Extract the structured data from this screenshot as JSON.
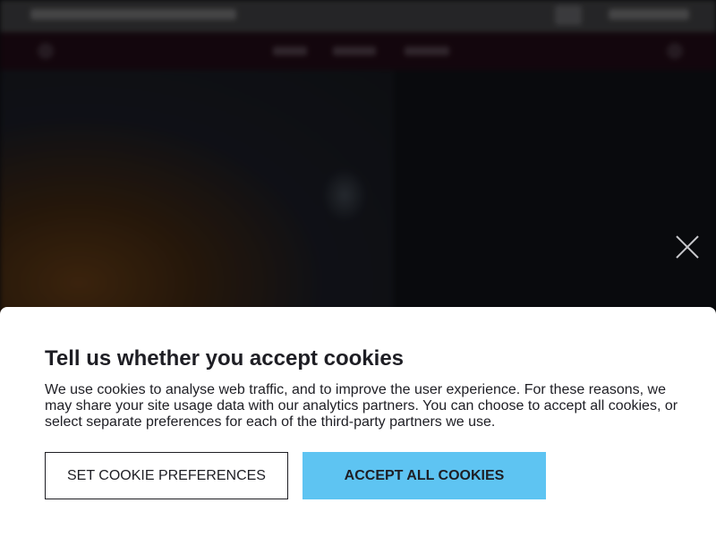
{
  "overlay": {
    "close_icon": "close-icon"
  },
  "cookie_banner": {
    "title": "Tell us whether you accept cookies",
    "description": "We use cookies to analyse web traffic, and to improve the user experience. For these reasons, we may share your site usage data with our analytics partners. You can choose to accept all cookies, or select separate preferences for each of the third-party partners we use.",
    "preferences_button": "SET COOKIE PREFERENCES",
    "accept_button": "ACCEPT ALL COOKIES"
  },
  "colors": {
    "accent": "#5ec4f2",
    "text": "#1e1e24",
    "banner_bg": "#ffffff"
  }
}
